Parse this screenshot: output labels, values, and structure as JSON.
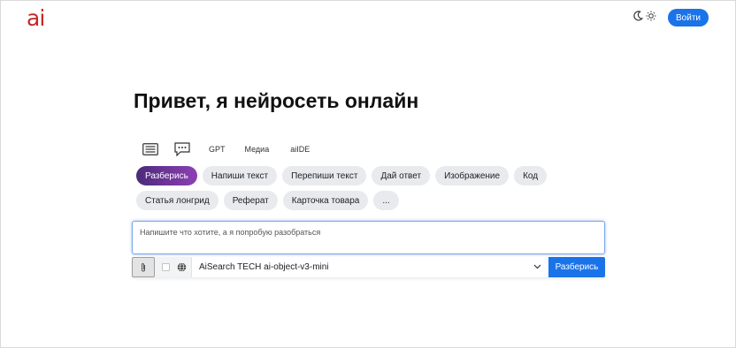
{
  "header": {
    "logo_text": "ai",
    "moon_icon": "moon-icon",
    "sun_icon": "sun-icon",
    "login_label": "Войти",
    "accent_color": "#1a73e8",
    "logo_color": "#c62828"
  },
  "main": {
    "title": "Привет, я нейросеть онлайн",
    "modes": [
      {
        "icon": "list-icon"
      },
      {
        "icon": "chat-icon"
      },
      {
        "label": "GPT"
      },
      {
        "label": "Медиа"
      },
      {
        "label": "aiIDE"
      }
    ],
    "chips_row1": [
      "Разберись",
      "Напиши текст",
      "Перепиши текст",
      "Дай ответ",
      "Изображение",
      "Код"
    ],
    "chips_row2": [
      "Статья лонгрид",
      "Реферат",
      "Карточка товара",
      "..."
    ],
    "active_chip": "Разберись"
  },
  "composer": {
    "placeholder": "Напишите что хотите, а я попробую разобраться",
    "attach_icon": "paperclip-icon",
    "globe_icon": "globe-icon",
    "model": "AiSearch TECH ai-object-v3-mini",
    "chevron_icon": "chevron-down-icon",
    "submit_label": "Разберись"
  }
}
